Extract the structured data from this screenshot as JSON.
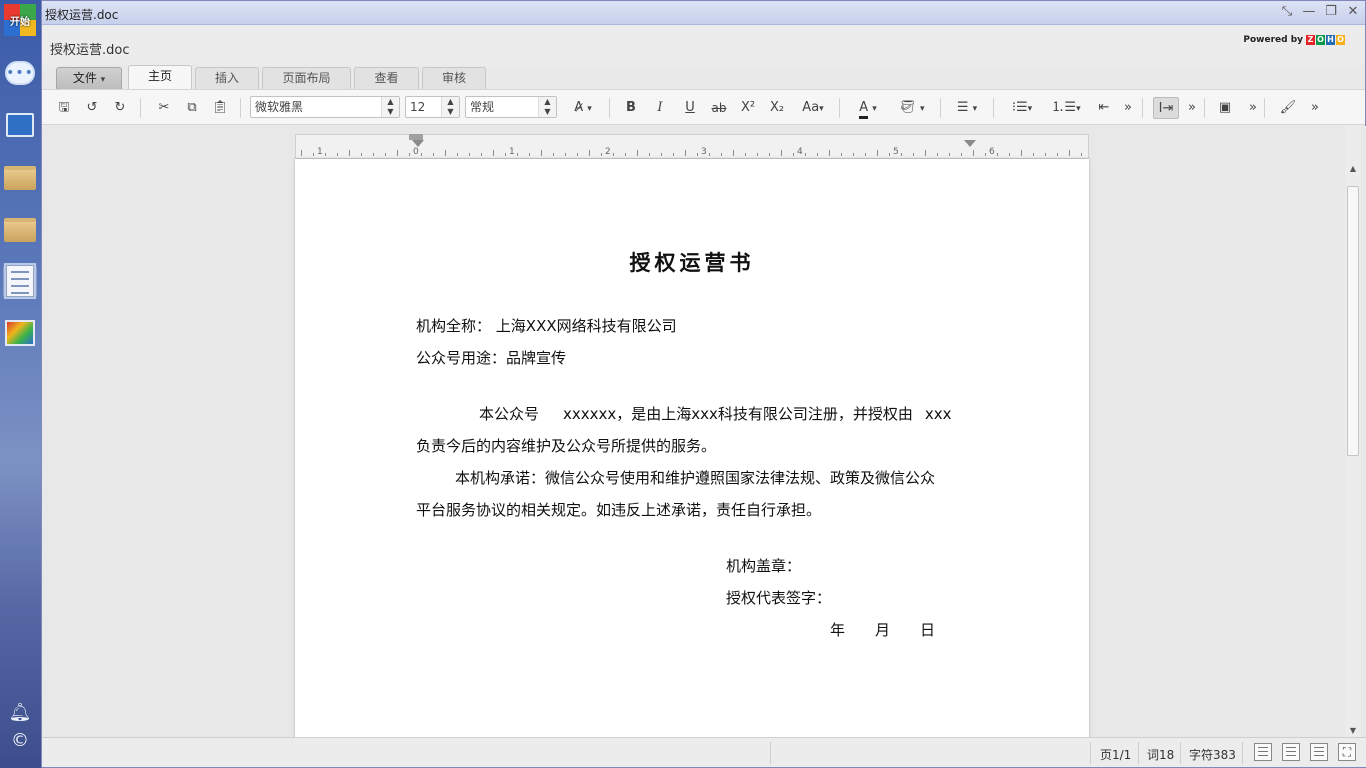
{
  "launcher": {
    "start_label": "开始"
  },
  "window": {
    "title": "授权运营.doc",
    "doc_name": "授权运营.doc",
    "powered_by": "Powered by",
    "zoho_letters": [
      "Z",
      "O",
      "H",
      "O"
    ],
    "zoho_colors": [
      "#e42527",
      "#089949",
      "#226db4",
      "#f9b21d"
    ]
  },
  "tabs": {
    "file": "文件",
    "home": "主页",
    "insert": "插入",
    "layout": "页面布局",
    "view": "查看",
    "review": "审核",
    "active": "主页"
  },
  "toolbar": {
    "font_family": "微软雅黑",
    "font_size": "12",
    "style": "常规",
    "bold": "B",
    "italic": "I",
    "underline": "U",
    "strikethrough": "ab",
    "superscript": "X²",
    "subscript": "X₂",
    "change_case": "Aa",
    "font_color_letter": "A",
    "font_color": "#222222"
  },
  "ruler": {
    "numbers": [
      "1",
      "0",
      "1",
      "2",
      "3",
      "4",
      "5",
      "6"
    ]
  },
  "document": {
    "title": "授权运营书",
    "org_name_label": "机构全称：",
    "org_name_value": "上海XXX网络科技有限公司",
    "purpose_label": "公众号用途：",
    "purpose_value": "品牌宣传",
    "para1_part1": "本公众号",
    "para1_part2": "xxxxxx，是由上海xxx科技有限公司注册，并授权由",
    "para1_part3": "xxx",
    "para1_line2": "负责今后的内容维护及公众号所提供的服务。",
    "para2_line1": "本机构承诺：微信公众号使用和维护遵照国家法律法规、政策及微信公众",
    "para2_line2": "平台服务协议的相关规定。如违反上述承诺，责任自行承担。",
    "seal_label": "机构盖章：",
    "sign_label": "授权代表签字：",
    "year": "年",
    "month": "月",
    "day": "日"
  },
  "statusbar": {
    "page": "页1/1",
    "words": "词18",
    "chars": "字符383"
  }
}
